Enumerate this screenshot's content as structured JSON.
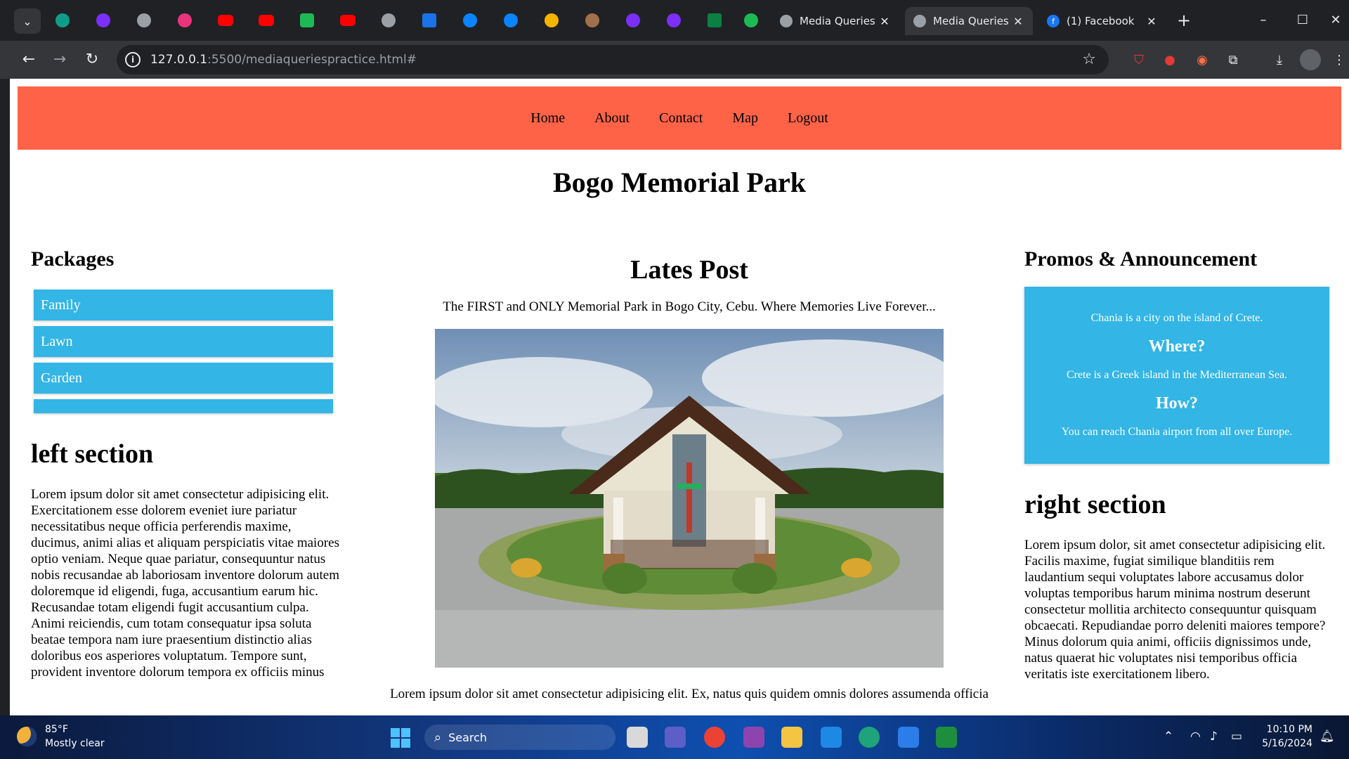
{
  "browser": {
    "tabs": [
      {
        "title": "Media Queries",
        "active": false
      },
      {
        "title": "Media Queries",
        "active": true
      },
      {
        "title": "(1) Facebook",
        "active": false
      }
    ],
    "url_host": "127.0.0.1",
    "url_rest": ":5500/mediaqueriespractice.html#"
  },
  "site": {
    "nav": [
      "Home",
      "About",
      "Contact",
      "Map",
      "Logout"
    ],
    "title": "Bogo Memorial Park",
    "left": {
      "packages_heading": "Packages",
      "packages": [
        "Family",
        "Lawn",
        "Garden",
        ""
      ],
      "section_heading": "left section",
      "text": "Lorem ipsum dolor sit amet consectetur adipisicing elit. Exercitationem esse dolorem eveniet iure pariatur necessitatibus neque officia perferendis maxime, ducimus, animi alias et aliquam perspiciatis vitae maiores optio veniam. Neque quae pariatur, consequuntur natus nobis recusandae ab laboriosam inventore dolorum autem doloremque id eligendi, fuga, accusantium earum hic. Recusandae totam eligendi fugit accusantium culpa. Animi reiciendis, cum totam consequatur ipsa soluta beatae tempora nam iure praesentium distinctio alias doloribus eos asperiores voluptatum. Tempore sunt, provident inventore dolorum tempora ex officiis minus"
    },
    "middle": {
      "heading": "Lates Post",
      "tagline": "The FIRST and ONLY Memorial Park in Bogo City, Cebu. Where Memories Live Forever...",
      "text": "Lorem ipsum dolor sit amet consectetur adipisicing elit. Ex, natus quis quidem omnis dolores assumenda officia"
    },
    "right": {
      "promos_heading": "Promos & Announcement",
      "promo_line1": "Chania is a city on the island of Crete.",
      "where_heading": "Where?",
      "where_text": "Crete is a Greek island in the Mediterranean Sea.",
      "how_heading": "How?",
      "how_text": "You can reach Chania airport from all over Europe.",
      "section_heading": "right section",
      "text": "Lorem ipsum dolor, sit amet consectetur adipisicing elit. Facilis maxime, fugiat similique blanditiis rem laudantium sequi voluptates labore accusamus dolor voluptas temporibus harum minima nostrum deserunt consectetur mollitia architecto consequuntur quisquam obcaecati. Repudiandae porro deleniti maiores tempore? Minus dolorum quia animi, officiis dignissimos unde, natus quaerat hic voluptates nisi temporibus officia veritatis iste exercitationem libero."
    }
  },
  "taskbar": {
    "temperature": "85°F",
    "weather": "Mostly clear",
    "search_label": "Search",
    "time": "10:10 PM",
    "date": "5/16/2024"
  },
  "colors": {
    "nav_bg": "#ff6347",
    "package_bg": "#33b5e5",
    "promo_bg": "#33b5e5"
  }
}
